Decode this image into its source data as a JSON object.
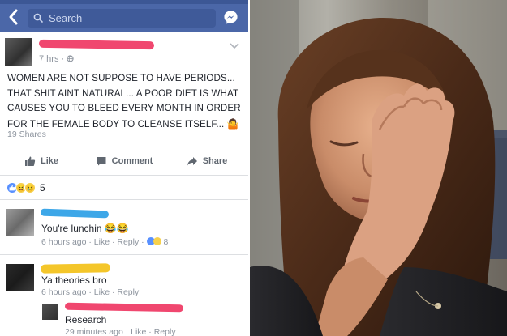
{
  "header": {
    "search_placeholder": "Search",
    "back_icon": "chevron-left-icon",
    "messenger_icon": "messenger-icon",
    "bar_color": "#4b67a8"
  },
  "post": {
    "time": "7 hrs · ",
    "text": "WOMEN ARE NOT SUPPOSE TO HAVE PERIODS... THAT SHIT AINT NATURAL... A POOR DIET IS WHAT CAUSES YOU TO BLEED EVERY MONTH IN ORDER FOR THE FEMALE BODY TO CLEANSE ITSELF...",
    "shares": "19 Shares",
    "actions": {
      "like": "Like",
      "comment": "Comment",
      "share": "Share"
    },
    "reactions_count": "5"
  },
  "comments": [
    {
      "text": "You're lunchin 😂😂",
      "meta": "6 hours ago · Like · Reply ·",
      "reaction_count": "8"
    },
    {
      "text": "Ya theories bro",
      "meta": "6 hours ago · Like · Reply"
    },
    {
      "text": "Research",
      "meta": "29 minutes ago · Like · Reply"
    }
  ]
}
